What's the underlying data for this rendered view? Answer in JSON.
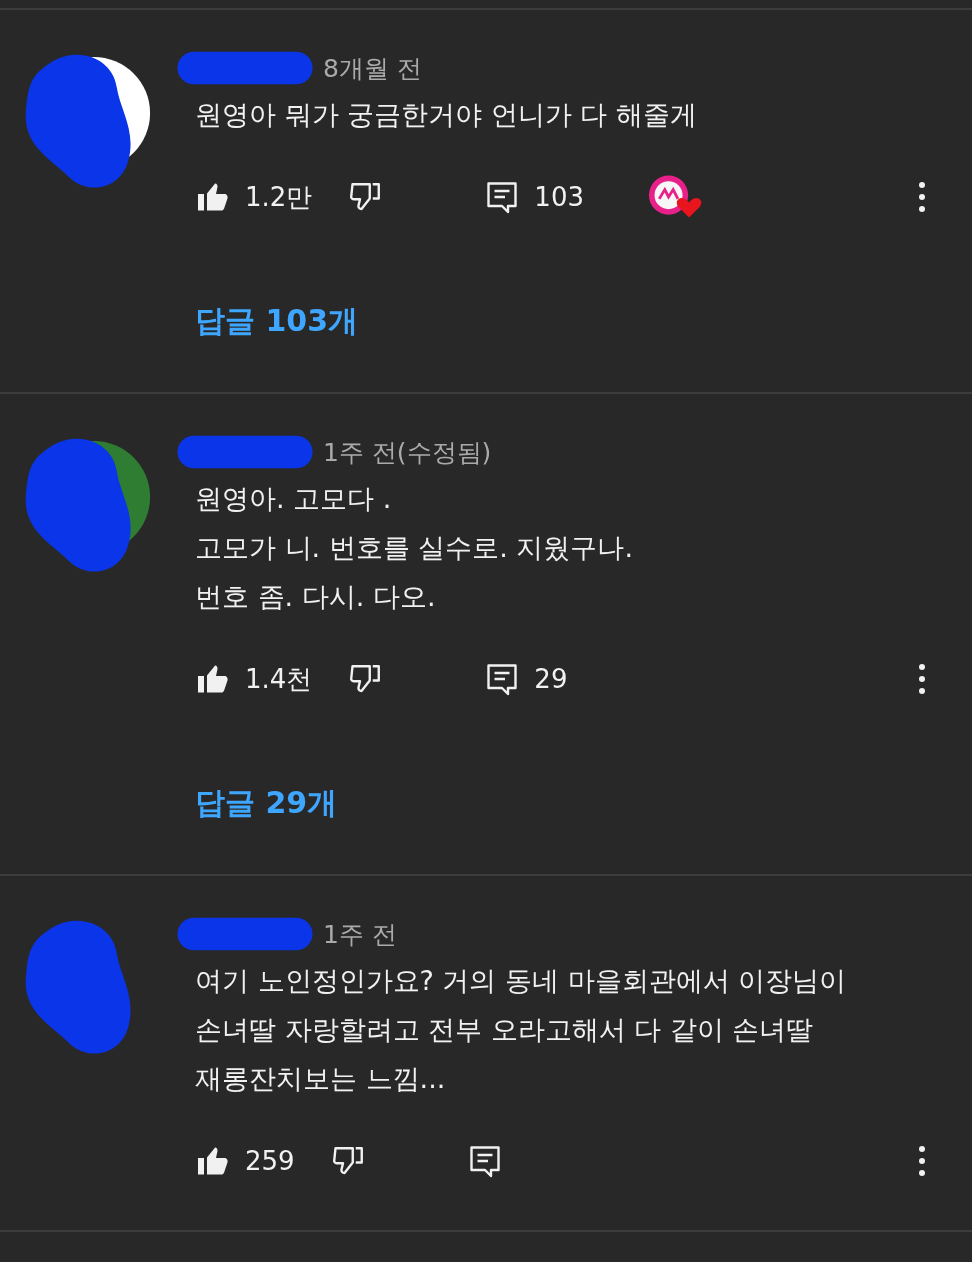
{
  "comments": [
    {
      "color": "#ffffff",
      "time": "8개월 전",
      "text": "원영아 뭐가 궁금한거야 언니가 다 해줄게",
      "likes": "1.2만",
      "reply_count": "103",
      "creator_heart": true,
      "replies_link": "답글 103개"
    },
    {
      "color": "#2e7d32",
      "time": "1주 전(수정됨)",
      "text": "원영아.  고모다 .\n고모가 니.  번호를 실수로.  지웠구나.\n번호 좀.  다시.  다오.",
      "likes": "1.4천",
      "reply_count": "29",
      "creator_heart": false,
      "replies_link": "답글 29개"
    },
    {
      "time": "1주 전",
      "text": "여기 노인정인가요? 거의 동네 마을회관에서 이장님이\n손녀딸 자랑할려고 전부 오라고해서 다 같이 손녀딸\n재롱잔치보는 느낌...",
      "likes": "259",
      "creator_heart": false
    }
  ]
}
